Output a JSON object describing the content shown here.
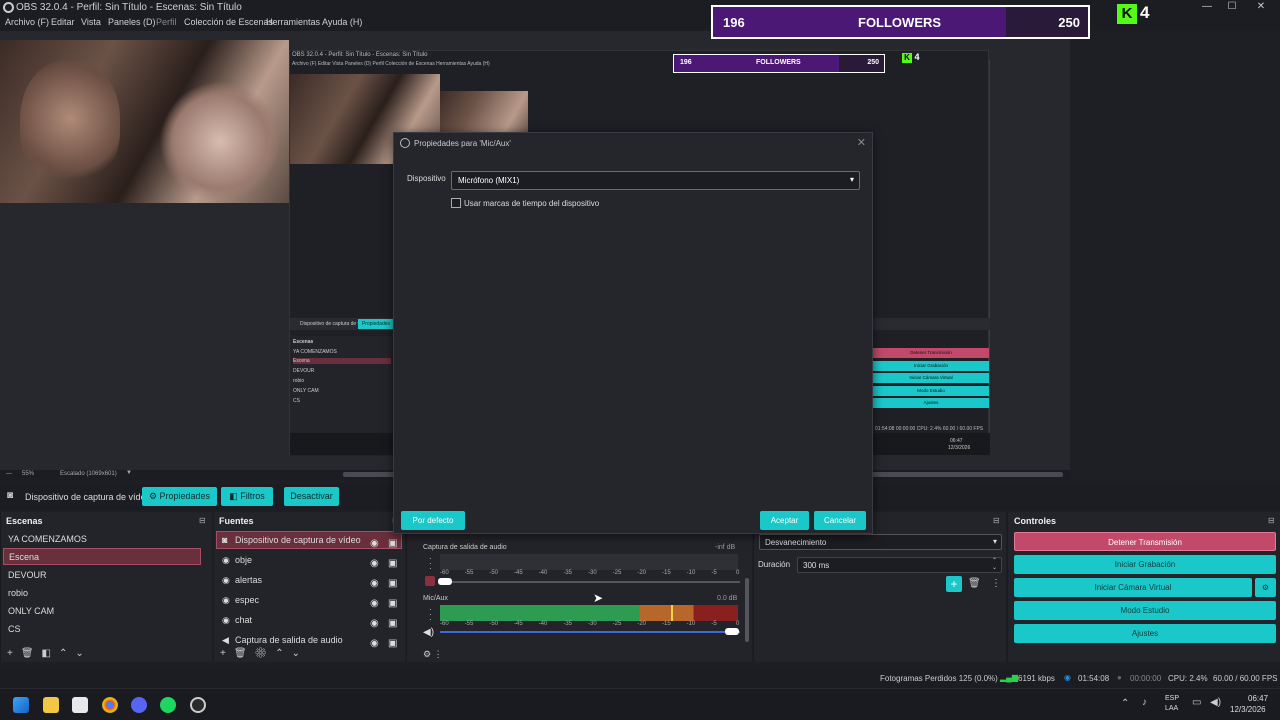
{
  "window": {
    "title": "OBS 32.0.4 - Perfil: Sin Título - Escenas: Sin Título",
    "min": "—",
    "max": "☐",
    "close": "✕"
  },
  "menu": [
    "Archivo (F)",
    "Editar",
    "Vista",
    "Paneles (D)",
    "Perfil",
    "Colección de Escenas",
    "Herramientas",
    "Ayuda (H)"
  ],
  "overlay": {
    "current": "196",
    "label": "FOLLOWERS",
    "goal": "250",
    "kick_count": "4",
    "progress": 0.78
  },
  "zoom": {
    "value": "55%",
    "scaled": "Escalado (1069x601)"
  },
  "source_bar": {
    "source_name": "Dispositivo de captura de vídeo",
    "properties": "Propiedades",
    "filters": "Filtros",
    "deactivate": "Desactivar"
  },
  "scenes": {
    "title": "Escenas",
    "items": [
      "YA COMENZAMOS",
      "Escena",
      "DEVOUR",
      "robio",
      "ONLY CAM",
      "CS"
    ],
    "selected": 1
  },
  "sources": {
    "title": "Fuentes",
    "items": [
      "Dispositivo de captura de vídeo",
      "obje",
      "alertas",
      "espec",
      "chat",
      "Captura de salida de audio"
    ]
  },
  "mixer": {
    "ch1_name": "Captura de salida de audio",
    "ch1_level": "-inf dB",
    "ch2_name": "Mic/Aux",
    "ch2_level": "0.0 dB",
    "ticks": [
      "-60",
      "-55",
      "-50",
      "-45",
      "-40",
      "-35",
      "-30",
      "-25",
      "-20",
      "-15",
      "-10",
      "-5",
      "0"
    ]
  },
  "transitions": {
    "type": "Desvanecimiento",
    "duration_label": "Duración",
    "duration": "300 ms"
  },
  "controls": {
    "title": "Controles",
    "stop_stream": "Detener Transmisión",
    "start_record": "Iniciar Grabación",
    "virtual_cam": "Iniciar Cámara Virtual",
    "studio_mode": "Modo Estudio",
    "settings": "Ajustes"
  },
  "status": {
    "dropped": "Fotogramas Perdidos 125 (0.0%)",
    "bitrate": "6191 kbps",
    "stream_time": "01:54:08",
    "rec_time": "00:00:00",
    "cpu": "CPU: 2.4%",
    "fps": "60.00 / 60.00 FPS"
  },
  "taskbar": {
    "lang1": "ESP",
    "lang2": "LAA",
    "time": "06:47",
    "date": "12/3/2026"
  },
  "dialog": {
    "title": "Propiedades para 'Mic/Aux'",
    "device_label": "Dispositivo",
    "device_value": "Micrófono (MIX1)",
    "timestamps_label": "Usar marcas de tiempo del dispositivo",
    "defaults": "Por defecto",
    "accept": "Aceptar",
    "cancel": "Cancelar"
  },
  "nested": {
    "title": "OBS 32.0.4 - Perfil: Sin Título - Escenas: Sin Título",
    "menu": "Archivo (F)  Editar  Vista  Paneles (D)  Perfil  Colección de Escenas  Herramientas  Ayuda (H)",
    "scene_title": "Escenas",
    "scenes": [
      "YA COMENZAMOS",
      "Escena",
      "DEVOUR",
      "robio",
      "ONLY CAM",
      "CS"
    ],
    "source_name": "Dispositivo de captura de vídeo",
    "properties": "Propiedades",
    "followers_current": "196",
    "followers_label": "FOLLOWERS",
    "followers_goal": "250",
    "kick_count": "4",
    "controls": [
      "Detener Transmisión",
      "Iniciar Grabación",
      "Iniciar Cámara Virtual",
      "Modo Estudio",
      "Ajustes"
    ],
    "status": "01:54:08   00:00:00   CPU: 2.4%   60.00 / 60.00 FPS",
    "time": "06:47",
    "date": "12/3/2026"
  },
  "colors": {
    "accent": "#1bc8c9",
    "stop": "#c2496a",
    "purple": "#4b1876",
    "kick": "#53fc18"
  }
}
